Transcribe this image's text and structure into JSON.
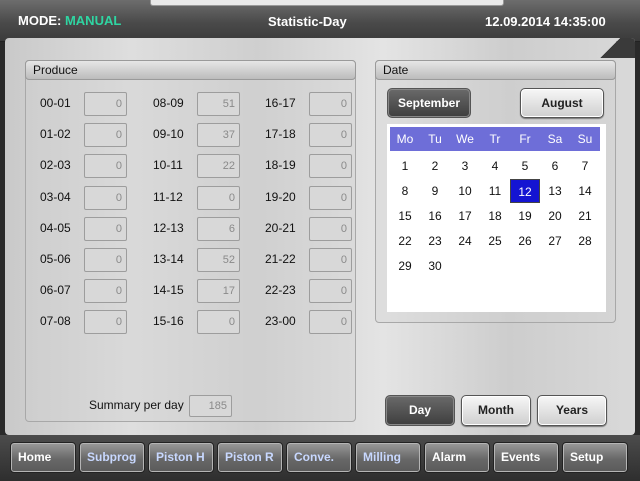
{
  "header": {
    "mode_label": "MODE:",
    "mode_value": "MANUAL",
    "title": "Statistic-Day",
    "datetime": "12.09.2014 14:35:00"
  },
  "produce": {
    "title": "Produce",
    "rows": [
      {
        "label": "00-01",
        "value": "0"
      },
      {
        "label": "01-02",
        "value": "0"
      },
      {
        "label": "02-03",
        "value": "0"
      },
      {
        "label": "03-04",
        "value": "0"
      },
      {
        "label": "04-05",
        "value": "0"
      },
      {
        "label": "05-06",
        "value": "0"
      },
      {
        "label": "06-07",
        "value": "0"
      },
      {
        "label": "07-08",
        "value": "0"
      },
      {
        "label": "08-09",
        "value": "51"
      },
      {
        "label": "09-10",
        "value": "37"
      },
      {
        "label": "10-11",
        "value": "22"
      },
      {
        "label": "11-12",
        "value": "0"
      },
      {
        "label": "12-13",
        "value": "6"
      },
      {
        "label": "13-14",
        "value": "52"
      },
      {
        "label": "14-15",
        "value": "17"
      },
      {
        "label": "15-16",
        "value": "0"
      },
      {
        "label": "16-17",
        "value": "0"
      },
      {
        "label": "17-18",
        "value": "0"
      },
      {
        "label": "18-19",
        "value": "0"
      },
      {
        "label": "19-20",
        "value": "0"
      },
      {
        "label": "20-21",
        "value": "0"
      },
      {
        "label": "21-22",
        "value": "0"
      },
      {
        "label": "22-23",
        "value": "0"
      },
      {
        "label": "23-00",
        "value": "0"
      }
    ],
    "summary_label": "Summary per day",
    "summary_value": "185"
  },
  "date": {
    "title": "Date",
    "current_month": "September",
    "other_month": "August",
    "weekdays": [
      "Mo",
      "Tu",
      "We",
      "Tr",
      "Fr",
      "Sa",
      "Su"
    ],
    "days": [
      "1",
      "2",
      "3",
      "4",
      "5",
      "6",
      "7",
      "8",
      "9",
      "10",
      "11",
      "12",
      "13",
      "14",
      "15",
      "16",
      "17",
      "18",
      "19",
      "20",
      "21",
      "22",
      "23",
      "24",
      "25",
      "26",
      "27",
      "28",
      "29",
      "30"
    ],
    "selected_day": "12",
    "first_weekday_index": 0
  },
  "period_buttons": {
    "day": "Day",
    "month": "Month",
    "years": "Years",
    "active": "day"
  },
  "footer": {
    "nav": [
      {
        "label": "Home",
        "alt": false
      },
      {
        "label": "Subprog",
        "alt": true
      },
      {
        "label": "Piston H",
        "alt": true
      },
      {
        "label": "Piston R",
        "alt": true
      },
      {
        "label": "Conve.",
        "alt": true
      },
      {
        "label": "Milling",
        "alt": true
      },
      {
        "label": "Alarm",
        "alt": false
      },
      {
        "label": "Events",
        "alt": false
      },
      {
        "label": "Setup",
        "alt": false
      }
    ]
  },
  "colors": {
    "mode_value": "#2fd5a2",
    "calendar_header": "#6e6ed8",
    "selected_day": "#1414d2"
  }
}
